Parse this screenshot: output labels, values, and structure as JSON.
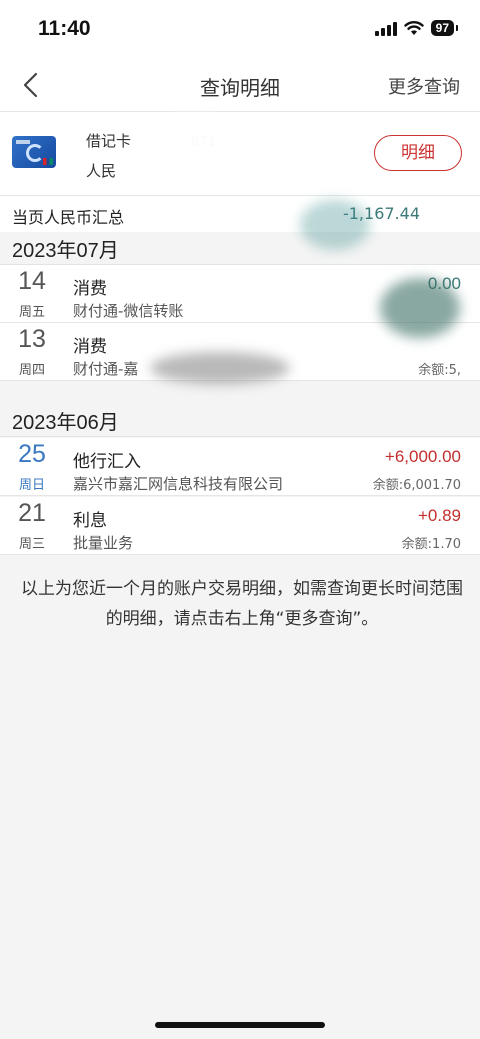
{
  "status_bar": {
    "time": "11:40",
    "battery": "97"
  },
  "nav": {
    "title": "查询明细",
    "more_label": "更多查询"
  },
  "card": {
    "name": "借记卡",
    "number_fragment": "871",
    "currency": "人民",
    "detail_button": "明细"
  },
  "summary": {
    "label": "当页人民币汇总",
    "amount": "-1,167.44"
  },
  "months": [
    {
      "label": "2023年07月",
      "transactions": [
        {
          "day": "14",
          "weekday": "周五",
          "type": "消费",
          "description": "财付通-微信转账",
          "amount": "0.00",
          "balance": ""
        },
        {
          "day": "13",
          "weekday": "周四",
          "type": "消费",
          "description": "财付通-嘉",
          "amount": "",
          "balance": "余额:5,"
        }
      ]
    },
    {
      "label": "2023年06月",
      "transactions": [
        {
          "day": "25",
          "weekday": "周日",
          "type": "他行汇入",
          "description": "嘉兴市嘉汇网信息科技有限公司",
          "amount": "+6,000.00",
          "balance": "余额:6,001.70"
        },
        {
          "day": "21",
          "weekday": "周三",
          "type": "利息",
          "description": "批量业务",
          "amount": "+0.89",
          "balance": "余额:1.70"
        }
      ]
    }
  ],
  "notice": "以上为您近一个月的账户交易明细，如需查询更长时间范围的明细，请点击右上角“更多查询”。",
  "colors": {
    "credit": "#c3302f",
    "debit": "#3b7a78",
    "accent_blue": "#3a78c0"
  }
}
